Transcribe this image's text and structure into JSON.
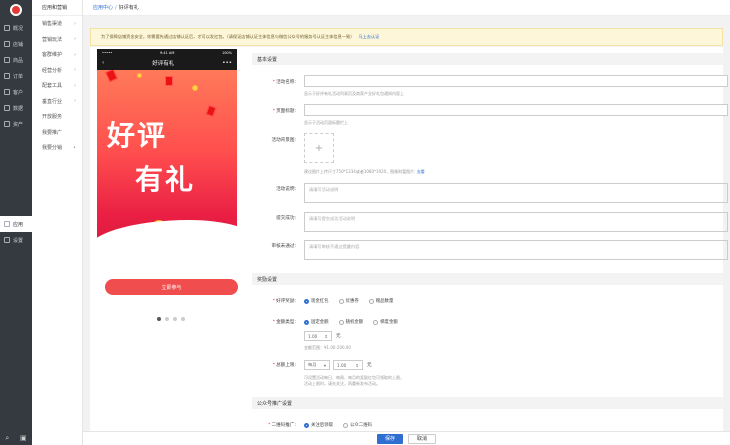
{
  "nav_primary": {
    "items": [
      {
        "label": "概况",
        "icon": "overview-icon"
      },
      {
        "label": "店铺",
        "icon": "store-icon"
      },
      {
        "label": "商品",
        "icon": "goods-icon"
      },
      {
        "label": "订单",
        "icon": "order-icon"
      },
      {
        "label": "客户",
        "icon": "customer-icon"
      },
      {
        "label": "数据",
        "icon": "data-icon"
      },
      {
        "label": "资产",
        "icon": "asset-icon"
      },
      {
        "label": "应用",
        "icon": "app-icon"
      },
      {
        "label": "设置",
        "icon": "settings-icon"
      }
    ],
    "active_index": 7
  },
  "nav_secondary": {
    "title": "应用和营销",
    "items": [
      {
        "label": "销售渠道",
        "arrow": "›"
      },
      {
        "label": "营销玩法",
        "arrow": "›"
      },
      {
        "label": "客群维护",
        "arrow": "›"
      },
      {
        "label": "经营分析",
        "arrow": "›"
      },
      {
        "label": "配套工具",
        "arrow": "›"
      },
      {
        "label": "垂直行业",
        "arrow": "›"
      },
      {
        "label": "开放服务",
        "arrow": ""
      },
      {
        "label": "我要推广",
        "arrow": ""
      },
      {
        "label": "我要分销",
        "arrow": "•"
      }
    ]
  },
  "breadcrumb": {
    "parent": "应用中心",
    "sep": "/",
    "current": "好评有礼"
  },
  "notice": {
    "text": "为了保障店铺资金安全，你需要先通过店铺认证后，才可以发红包。（请保证店铺认证主体信息与微信公众号的服务号认证主体信息一致）",
    "link": "马上去认证"
  },
  "phone": {
    "carrier": "•••••",
    "time": "9:41 AM",
    "battery": "100%",
    "title": "好评有礼",
    "back": "‹",
    "more": "•••",
    "poster_line1": "好评",
    "poster_line2": "有礼",
    "join_button": "立即参与"
  },
  "sections": {
    "basic": "基本设置",
    "reward": "奖励设置",
    "promo": "公众号推广设置"
  },
  "fields": {
    "name_label": "活动名称:",
    "name_hint": "显示于好评有礼活动列表页及商家产业好礼包通知内容上",
    "page_title_label": "页面标题:",
    "page_title_hint": "显示于活动页面标题栏上",
    "bg_label": "活动背景图:",
    "bg_hint": "建议图片上传尺寸750*1334或者1080*1920，图像财富图片:",
    "bg_link": "去看",
    "desc_label": "活动说明:",
    "desc_placeholder": "请填写活动说明",
    "success_label": "提交成功:",
    "success_placeholder": "请填写提交成功活动说明",
    "fail_label": "审核未通过:",
    "fail_placeholder": "请填写审核不通过提醒内容",
    "reward_type_label": "好评奖励:",
    "reward_types": [
      "现金红包",
      "优惠券",
      "赠品数量"
    ],
    "amount_type_label": "金额类型:",
    "amount_types": [
      "固定金额",
      "随机金额",
      "梯度金额"
    ],
    "amount_value": "1.00",
    "amount_unit": "元",
    "amount_hint": "金额范围：¥1.00-200.00",
    "limit_label": "总额上限:",
    "limit_period": "每月",
    "limit_value": "1.00",
    "limit_unit": "元",
    "limit_hint1": "可设置活动每日、每周、每月的奖励红包可领取的上限，",
    "limit_hint2": "活动上限时，请先关注，再重新发布活动。",
    "qr_label": "二维码推广:",
    "qr_options": [
      "关注后领取",
      "公众二维码"
    ]
  },
  "footer": {
    "save": "保存",
    "cancel": "取消"
  }
}
